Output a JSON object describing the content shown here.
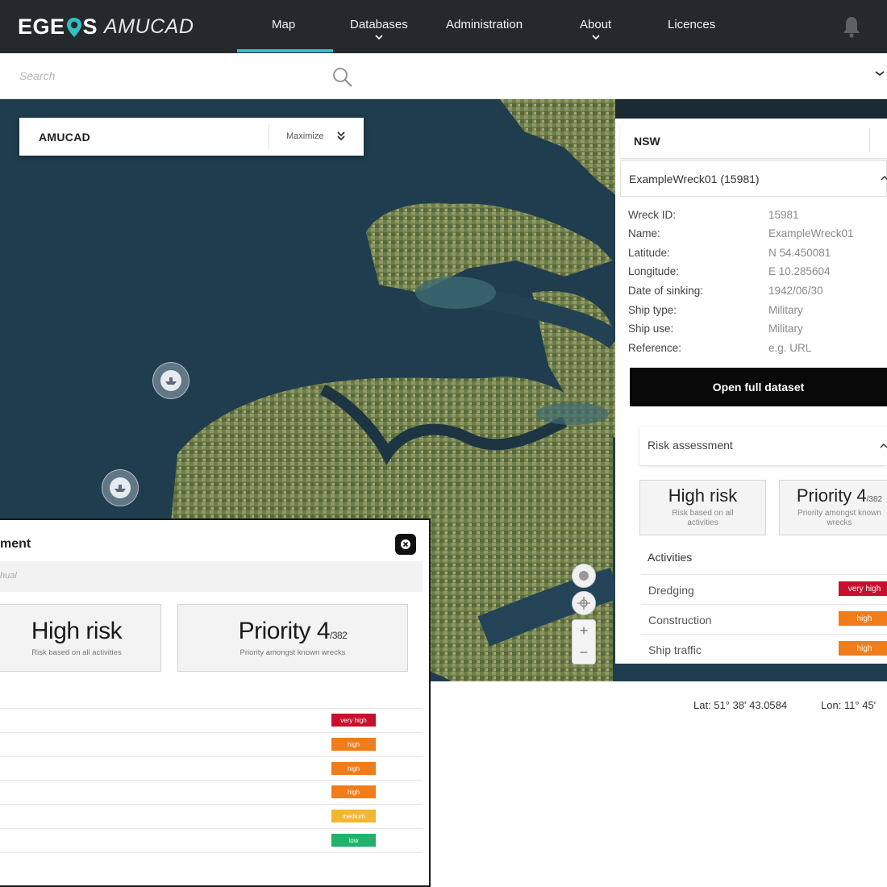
{
  "app": {
    "logo_main_pre": "EGE",
    "logo_main_post": "S",
    "logo_sub": "AMUCAD"
  },
  "nav": {
    "items": [
      {
        "label": "Map",
        "active": true
      },
      {
        "label": "Databases",
        "dropdown": true
      },
      {
        "label": "Administration"
      },
      {
        "label": "About",
        "dropdown": true
      },
      {
        "label": "Licences"
      }
    ],
    "accent_color": "#2fc0c5",
    "bell_icon": "bell-icon"
  },
  "search": {
    "placeholder": "Search",
    "icon": "search-icon"
  },
  "map_overlay": {
    "title": "AMUCAD",
    "maximize_label": "Maximize"
  },
  "detail_panel": {
    "tab_title": "NSW",
    "wreck_title": "ExampleWreck01 (15981)",
    "fields": [
      {
        "label": "Wreck ID:",
        "value": "15981"
      },
      {
        "label": "Name:",
        "value": "ExampleWreck01"
      },
      {
        "label": "Latitude:",
        "value": "N 54.450081"
      },
      {
        "label": "Longitude:",
        "value": "E 10.285604"
      },
      {
        "label": "Date of sinking:",
        "value": "1942/06/30"
      },
      {
        "label": "Ship type:",
        "value": "Military"
      },
      {
        "label": "Ship use:",
        "value": "Military"
      },
      {
        "label": "Reference:",
        "value": "e.g. URL"
      }
    ],
    "open_button": "Open full dataset",
    "risk_section_title": "Risk assessment",
    "risk_card": {
      "title": "High risk",
      "subtitle": "Risk based on all activities"
    },
    "priority_card": {
      "title": "Priority 4",
      "suffix": "/382",
      "subtitle": "Priority amongst known wrecks"
    },
    "activities_title": "Activities",
    "activities": [
      {
        "name": "Dredging",
        "level": "very high",
        "color": "#c8102e"
      },
      {
        "name": "Construction",
        "level": "high",
        "color": "#f07c1a"
      },
      {
        "name": "Ship traffic",
        "level": "high",
        "color": "#f07c1a"
      }
    ]
  },
  "coordinates": {
    "lat": "Lat: 51° 38' 43.0584",
    "lon": "Lon: 11° 45'"
  },
  "risk_panel": {
    "title": "ment",
    "subtext": "hual",
    "risk_card": {
      "title": "High risk",
      "subtitle": "Risk based on all activities"
    },
    "priority_card": {
      "title": "Priority 4",
      "suffix": "/382",
      "subtitle": "Priority amongst known wrecks"
    },
    "badges": [
      {
        "level": "very high",
        "color": "#c8102e"
      },
      {
        "level": "high",
        "color": "#f07c1a"
      },
      {
        "level": "high",
        "color": "#f07c1a"
      },
      {
        "level": "high",
        "color": "#f07c1a"
      },
      {
        "level": "medium",
        "color": "#f2b630"
      },
      {
        "level": "low",
        "color": "#21b36b"
      }
    ]
  }
}
